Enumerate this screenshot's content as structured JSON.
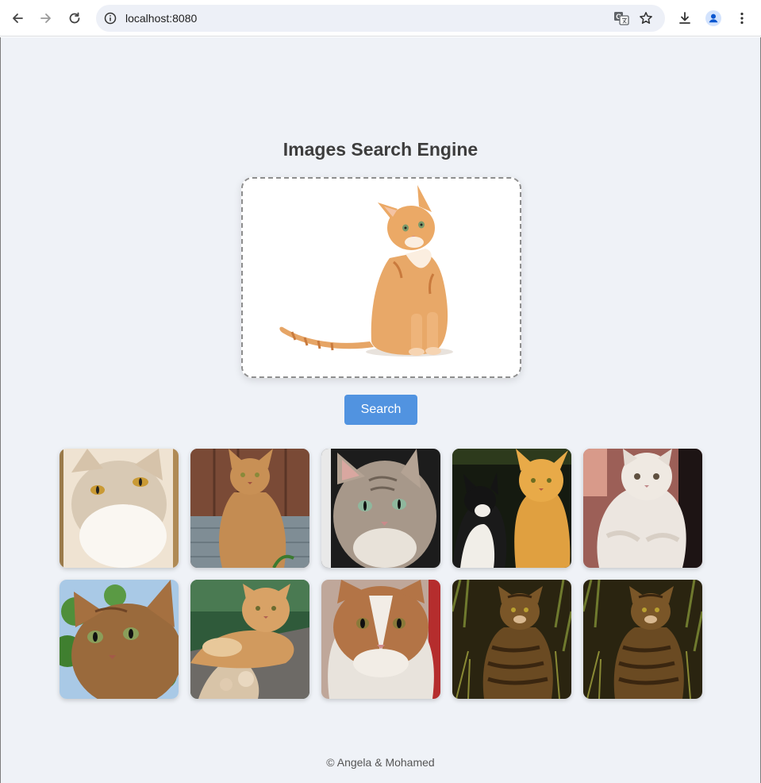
{
  "browser": {
    "url": "localhost:8080",
    "icons": [
      "back-arrow-icon",
      "forward-arrow-icon",
      "reload-icon",
      "site-info-icon",
      "translate-icon",
      "bookmark-star-icon",
      "download-icon",
      "profile-icon",
      "menu-icon"
    ]
  },
  "page": {
    "title": "Images Search Engine",
    "search_button": "Search",
    "footer": "© Angela & Mohamed"
  },
  "query_image": {
    "subject": "orange tabby cat sitting on white background"
  },
  "results": [
    {
      "subject": "cream and white cat close-up"
    },
    {
      "subject": "orange tabby cat sitting on wooden porch"
    },
    {
      "subject": "tabby cat with green eyes"
    },
    {
      "subject": "black and white cat beside orange cat"
    },
    {
      "subject": "white fluffy cat held in arms"
    },
    {
      "subject": "orange cat face among leaves"
    },
    {
      "subject": "orange long-haired cat lying on rock"
    },
    {
      "subject": "orange and white cat face"
    },
    {
      "subject": "brown tabby cat sitting in grass"
    },
    {
      "subject": "brown tabby cat sitting in grass"
    }
  ],
  "colors": {
    "page_background": "#eff2f7",
    "accent": "#5193e0",
    "title_text": "#3d3d3d",
    "omnibox": "#edf0f7"
  }
}
